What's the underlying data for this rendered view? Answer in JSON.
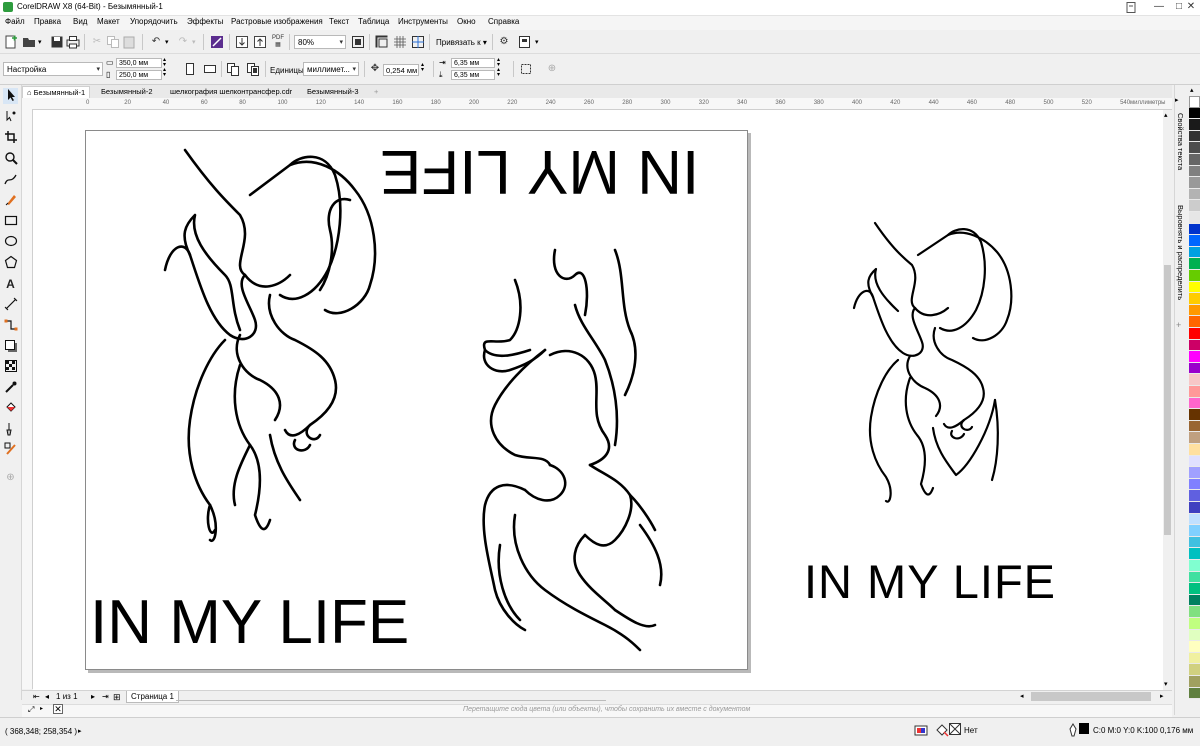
{
  "window": {
    "title": "CorelDRAW X8 (64-Bit) - Безымянный-1",
    "controls": [
      "—",
      "□",
      "✕"
    ]
  },
  "menu": [
    "Файл",
    "Правка",
    "Вид",
    "Макет",
    "Упорядочить",
    "Эффекты",
    "Растровые изображения",
    "Текст",
    "Таблица",
    "Инструменты",
    "Окно",
    "Справка"
  ],
  "toolbar": {
    "zoom": "80%",
    "snap_label": "Привязать к"
  },
  "property_bar": {
    "preset": "Настройка",
    "width": "350,0 мм",
    "height": "250,0 мм",
    "units_label": "Единицы:",
    "units": "миллимет...",
    "nudge": "0,254 мм",
    "dup_x": "6,35 мм",
    "dup_y": "6,35 мм"
  },
  "doc_tabs": [
    "Безымянный-1",
    "Безымянный-2",
    "шелкография шелконтрансфер.cdr",
    "Безымянный-3"
  ],
  "ruler": {
    "labels": [
      "0",
      "20",
      "40",
      "60",
      "80",
      "100",
      "120",
      "140",
      "160",
      "180",
      "200",
      "220",
      "240",
      "260",
      "280",
      "300",
      "320",
      "340",
      "360",
      "380",
      "400",
      "420",
      "440",
      "460",
      "480",
      "500",
      "520",
      "540"
    ],
    "unit": "миллиметры"
  },
  "canvas": {
    "text_upside_down": "IN MY LIFE",
    "text_bottom": "IN MY LIFE",
    "text_right": "IN MY LIFE"
  },
  "page_nav": {
    "page_index": "1",
    "of_label": "из",
    "page_count": "1",
    "page_tab": "Страница 1"
  },
  "palette_tray_hint": "Перетащите сюда цвета (или объекты), чтобы сохранить их вместе с документом",
  "status": {
    "coords": "( 368,348; 258,354 )",
    "fill_label": "Нет",
    "outline": "C:0 M:0 Y:0 K:100  0,176 мм"
  },
  "dockers": [
    "Свойства текста",
    "Выровнять и распределить"
  ],
  "palette_colors": [
    "#ffffff",
    "#000000",
    "#1a1a1a",
    "#333333",
    "#4d4d4d",
    "#666666",
    "#808080",
    "#999999",
    "#b3b3b3",
    "#cccccc",
    "#e6e6e6",
    "#0033cc",
    "#0066ff",
    "#00a0e0",
    "#00b050",
    "#66cc00",
    "#ffff00",
    "#ffcc00",
    "#ff9900",
    "#ff6600",
    "#ff0000",
    "#cc0066",
    "#ff00ff",
    "#9900cc",
    "#f7c7c7",
    "#ff9999",
    "#ff66cc",
    "#663300",
    "#996633",
    "#c0a080",
    "#ffe0a0",
    "#e0e0ff",
    "#a0a0ff",
    "#8080ff",
    "#6060e0",
    "#4040c0",
    "#c0e0ff",
    "#80d0ff",
    "#40c0e0",
    "#00c0c0",
    "#80ffd0",
    "#40e0a0",
    "#00c080",
    "#008060",
    "#80e080",
    "#c0ff80",
    "#e0ffc0",
    "#ffffc0",
    "#f0f0a0",
    "#d0d080",
    "#a0a060",
    "#608040"
  ]
}
